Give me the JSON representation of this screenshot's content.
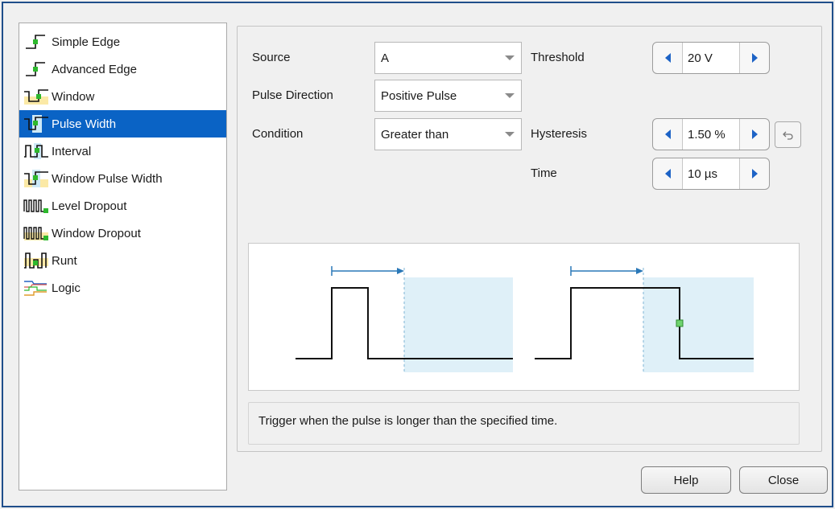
{
  "trigger_types": [
    {
      "label": "Simple Edge",
      "icon": "simple-edge-icon",
      "selected": false
    },
    {
      "label": "Advanced Edge",
      "icon": "advanced-edge-icon",
      "selected": false
    },
    {
      "label": "Window",
      "icon": "window-icon",
      "selected": false
    },
    {
      "label": "Pulse Width",
      "icon": "pulse-width-icon",
      "selected": true
    },
    {
      "label": "Interval",
      "icon": "interval-icon",
      "selected": false
    },
    {
      "label": "Window Pulse Width",
      "icon": "window-pulse-width-icon",
      "selected": false
    },
    {
      "label": "Level Dropout",
      "icon": "level-dropout-icon",
      "selected": false
    },
    {
      "label": "Window Dropout",
      "icon": "window-dropout-icon",
      "selected": false
    },
    {
      "label": "Runt",
      "icon": "runt-icon",
      "selected": false
    },
    {
      "label": "Logic",
      "icon": "logic-icon",
      "selected": false
    }
  ],
  "settings": {
    "source": {
      "label": "Source",
      "value": "A"
    },
    "pulse_direction": {
      "label": "Pulse Direction",
      "value": "Positive Pulse"
    },
    "condition": {
      "label": "Condition",
      "value": "Greater than"
    },
    "threshold": {
      "label": "Threshold",
      "value": "20 V"
    },
    "hysteresis": {
      "label": "Hysteresis",
      "value": "1.50 %"
    },
    "time": {
      "label": "Time",
      "value": "10 µs"
    }
  },
  "description": "Trigger when the pulse is longer than the specified time.",
  "buttons": {
    "help": "Help",
    "close": "Close"
  },
  "colors": {
    "selection": "#0a63c5",
    "accent_arrow": "#1d63c6",
    "trigger_region": "#dff0f8",
    "trigger_marker": "#6fd36f"
  }
}
